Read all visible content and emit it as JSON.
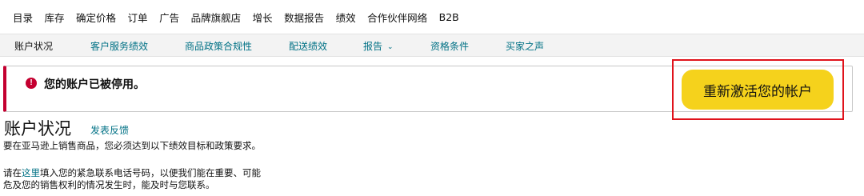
{
  "topnav": {
    "items": [
      "目录",
      "库存",
      "确定价格",
      "订单",
      "广告",
      "品牌旗舰店",
      "增长",
      "数据报告",
      "绩效",
      "合作伙伴网络",
      "B2B"
    ]
  },
  "subnav": {
    "items": [
      "账户状况",
      "客户服务绩效",
      "商品政策合规性",
      "配送绩效",
      "报告",
      "资格条件",
      "买家之声"
    ],
    "active_index": 0,
    "dropdown_label": "报告",
    "caret_glyph": "⌄"
  },
  "alert": {
    "icon_glyph": "!",
    "message": "您的账户已被停用。",
    "color": "#c40030"
  },
  "reactivate": {
    "label": "重新激活您的帐户",
    "color": "#f5d21c",
    "highlight_color": "#e0131c"
  },
  "page": {
    "title": "账户状况",
    "feedback_link": "发表反馈",
    "para1": "要在亚马逊上销售商品，您必须达到以下绩效目标和政策要求。",
    "para2_prefix": "请在",
    "para2_link": "这里",
    "para2_suffix": "填入您的紧急联系电话号码，以便我们能在重要、可能危及您的销售权利的情况发生时，能及时与您联系。"
  },
  "colors": {
    "link": "#007185",
    "text": "#111111"
  }
}
